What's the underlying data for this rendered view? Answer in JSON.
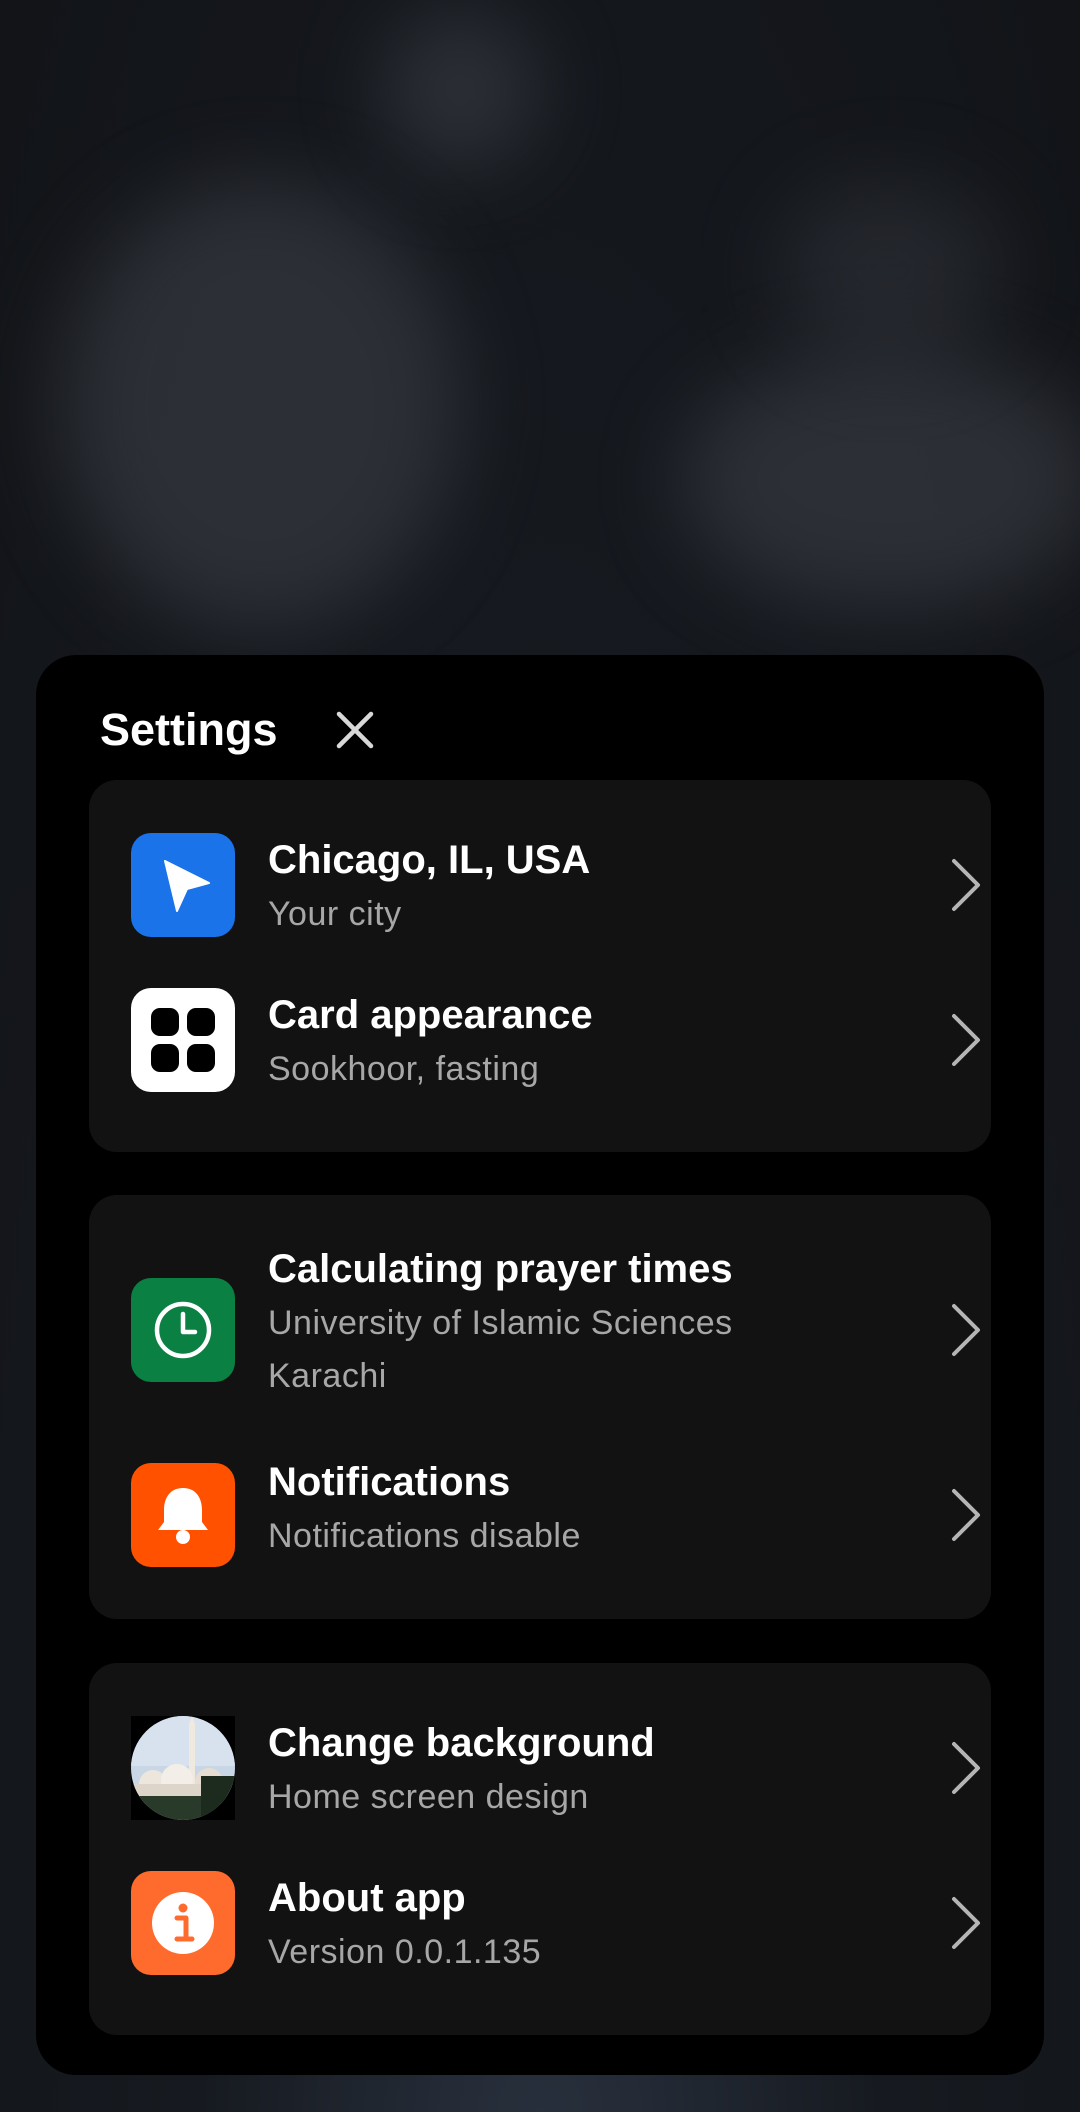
{
  "settings": {
    "title": "Settings",
    "close_icon": "close-icon",
    "rows": {
      "city": {
        "title": "Chicago, IL, USA",
        "subtitle": "Your city",
        "icon": "location-arrow-icon",
        "icon_color": "#1A73E8"
      },
      "appearance": {
        "title": "Card appearance",
        "subtitle": "Sookhoor, fasting",
        "icon": "grid-icon",
        "icon_color": "#FFFFFF"
      },
      "prayer": {
        "title": "Calculating prayer times",
        "subtitle": "University of Islamic Sciences Karachi",
        "icon": "clock-icon",
        "icon_color": "#0B8043"
      },
      "notifications": {
        "title": "Notifications",
        "subtitle": "Notifications disable",
        "icon": "bell-icon",
        "icon_color": "#FF5100"
      },
      "background": {
        "title": "Change background",
        "subtitle": "Home screen design",
        "icon": "mosque-thumbnail"
      },
      "about": {
        "title": "About app",
        "subtitle": "Version 0.0.1.135",
        "icon": "info-icon",
        "icon_color": "#FF6B2C"
      }
    },
    "chevron_icon": "chevron-right-icon"
  },
  "colors": {
    "sheet_bg": "#000000",
    "card_bg": "#121212",
    "subtitle_text": "#A7A7A7"
  }
}
